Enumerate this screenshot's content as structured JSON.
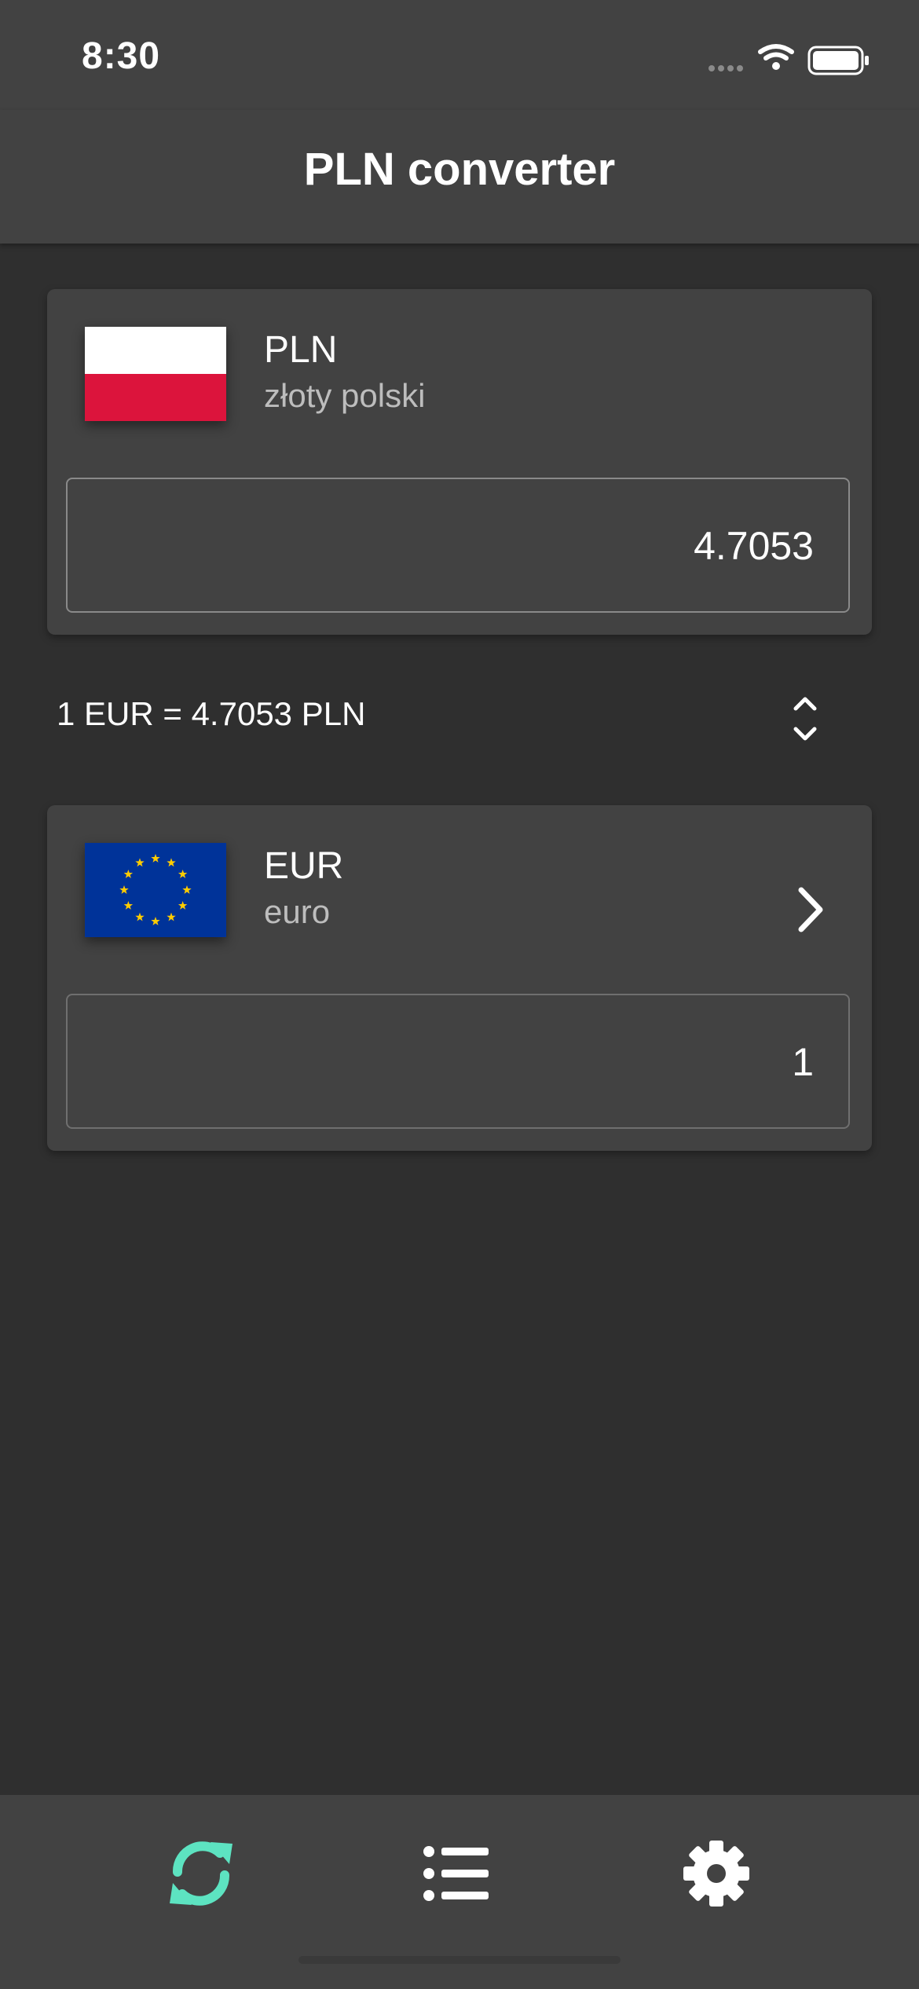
{
  "status_bar": {
    "time": "8:30"
  },
  "header": {
    "title": "PLN converter"
  },
  "source_currency": {
    "code": "PLN",
    "name": "złoty polski",
    "amount": "4.7053",
    "flag_icon": "poland-flag-icon"
  },
  "rate": {
    "text": "1 EUR = 4.7053 PLN"
  },
  "target_currency": {
    "code": "EUR",
    "name": "euro",
    "amount": "1",
    "flag_icon": "eu-flag-icon"
  },
  "tabs": [
    {
      "icon": "refresh-icon",
      "active": true
    },
    {
      "icon": "list-icon",
      "active": false
    },
    {
      "icon": "gear-icon",
      "active": false
    }
  ],
  "colors": {
    "accent": "#5de3c1",
    "background": "#2f2f2f",
    "surface": "#424242"
  }
}
